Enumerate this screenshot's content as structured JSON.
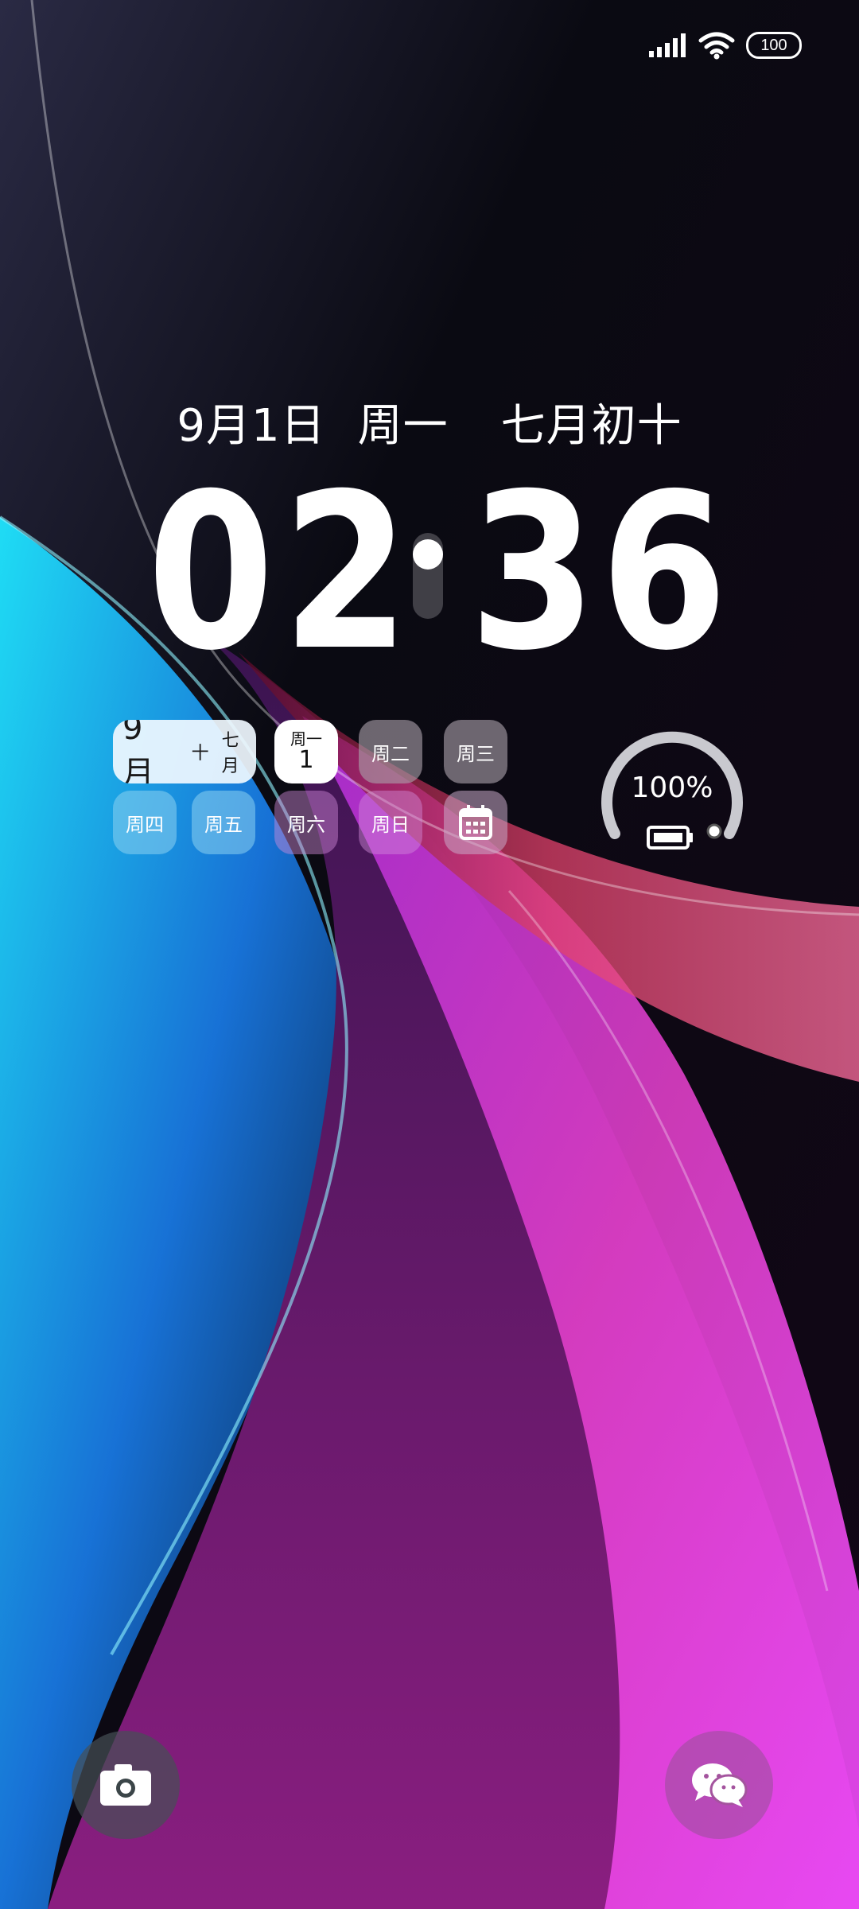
{
  "status_bar": {
    "signal_icon": "signal-bars-icon",
    "wifi_icon": "wifi-icon",
    "battery_level": "100"
  },
  "lock_screen": {
    "date": "9月1日",
    "weekday": "周一",
    "lunar_date": "七月初十",
    "time_digits": [
      "0",
      "2",
      "3",
      "6"
    ]
  },
  "calendar_widget": {
    "month": "9月",
    "month_extra": "十",
    "lunar_short": "七月",
    "today_weekday": "周一",
    "today_day": "1",
    "weekdays": [
      "周二",
      "周三",
      "周四",
      "周五",
      "周六",
      "周日"
    ],
    "calendar_icon": "calendar-icon"
  },
  "battery_widget": {
    "percent_text": "100%",
    "level": 1.0,
    "battery_icon": "battery-icon"
  },
  "quick_actions": {
    "camera_icon": "camera-icon",
    "wechat_icon": "wechat-icon"
  }
}
